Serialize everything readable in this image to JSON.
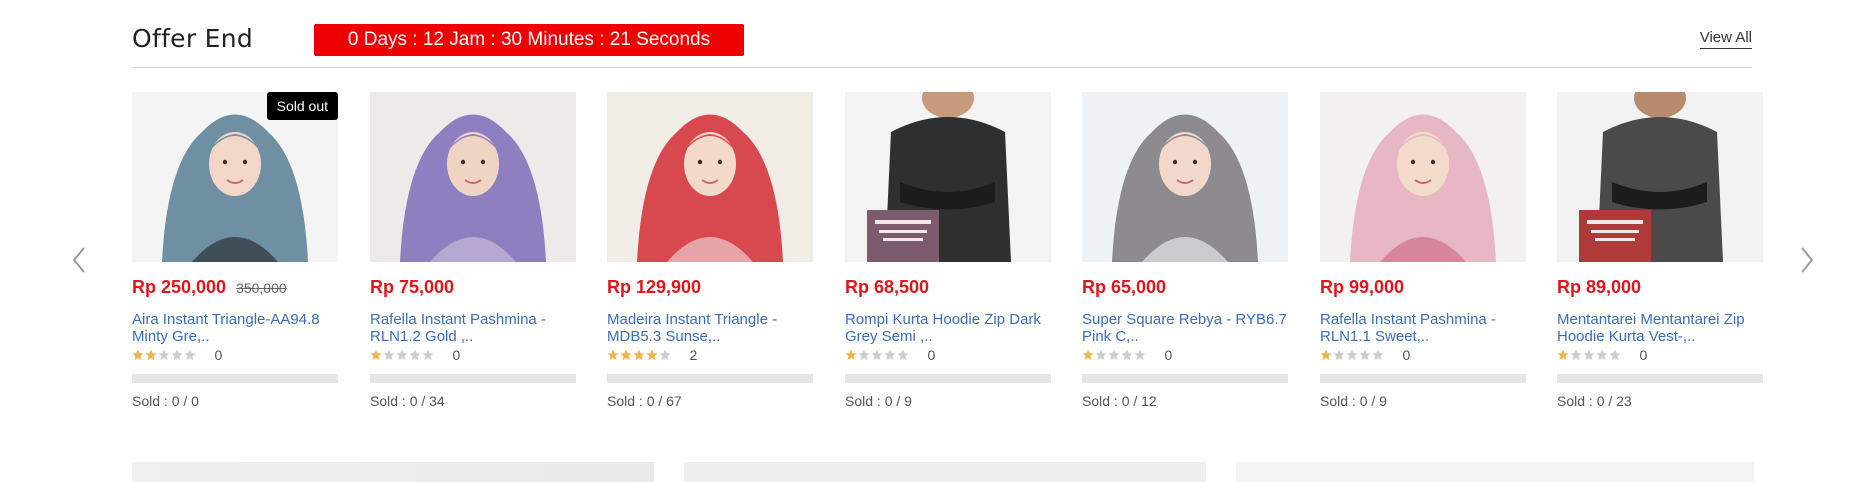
{
  "header": {
    "title": "Offer End",
    "countdown": "0 Days : 12 Jam : 30 Minutes : 21 Seconds",
    "view_all": "View All"
  },
  "navigation": {
    "prev_icon": "chevron-left-icon",
    "next_icon": "chevron-right-icon"
  },
  "colors": {
    "accent": "#ee0000",
    "price": "#e0161d",
    "link": "#3a6fb6",
    "star_on": "#f0b54a",
    "star_off": "#cccccc"
  },
  "products": [
    {
      "badge": "Sold out",
      "price": "Rp 250,000",
      "old_price": "350,000",
      "name": "Aira Instant Triangle-AA94.8 Minty Gre,..",
      "stars": 2,
      "rating_count": "0",
      "sold": "Sold : 0 / 0",
      "sold_fraction": 0,
      "image": "hijab-blue"
    },
    {
      "badge": "",
      "price": "Rp 75,000",
      "old_price": "",
      "name": "Rafella Instant Pashmina - RLN1.2 Gold ,..",
      "stars": 1,
      "rating_count": "0",
      "sold": "Sold : 0 / 34",
      "sold_fraction": 0,
      "image": "hijab-purple"
    },
    {
      "badge": "",
      "price": "Rp 129,900",
      "old_price": "",
      "name": "Madeira Instant Triangle - MDB5.3 Sunse,..",
      "stars": 4,
      "rating_count": "2",
      "sold": "Sold : 0 / 67",
      "sold_fraction": 0,
      "image": "hijab-red"
    },
    {
      "badge": "",
      "price": "Rp 68,500",
      "old_price": "",
      "name": "Rompi Kurta Hoodie Zip Dark Grey Semi ,..",
      "stars": 1,
      "rating_count": "0",
      "sold": "Sold : 0 / 9",
      "sold_fraction": 0,
      "image": "kurta-dark"
    },
    {
      "badge": "",
      "price": "Rp 65,000",
      "old_price": "",
      "name": "Super Square Rebya - RYB6.7 Pink C,..",
      "stars": 1,
      "rating_count": "0",
      "sold": "Sold : 0 / 12",
      "sold_fraction": 0,
      "image": "hijab-grey"
    },
    {
      "badge": "",
      "price": "Rp 99,000",
      "old_price": "",
      "name": "Rafella Instant Pashmina - RLN1.1 Sweet,..",
      "stars": 1,
      "rating_count": "0",
      "sold": "Sold : 0 / 9",
      "sold_fraction": 0,
      "image": "hijab-pink"
    },
    {
      "badge": "",
      "price": "Rp 89,000",
      "old_price": "",
      "name": "Mentantarei Mentantarei Zip Hoodie Kurta Vest-,..",
      "stars": 1,
      "rating_count": "0",
      "sold": "Sold : 0 / 23",
      "sold_fraction": 0,
      "image": "vest-grey"
    }
  ]
}
